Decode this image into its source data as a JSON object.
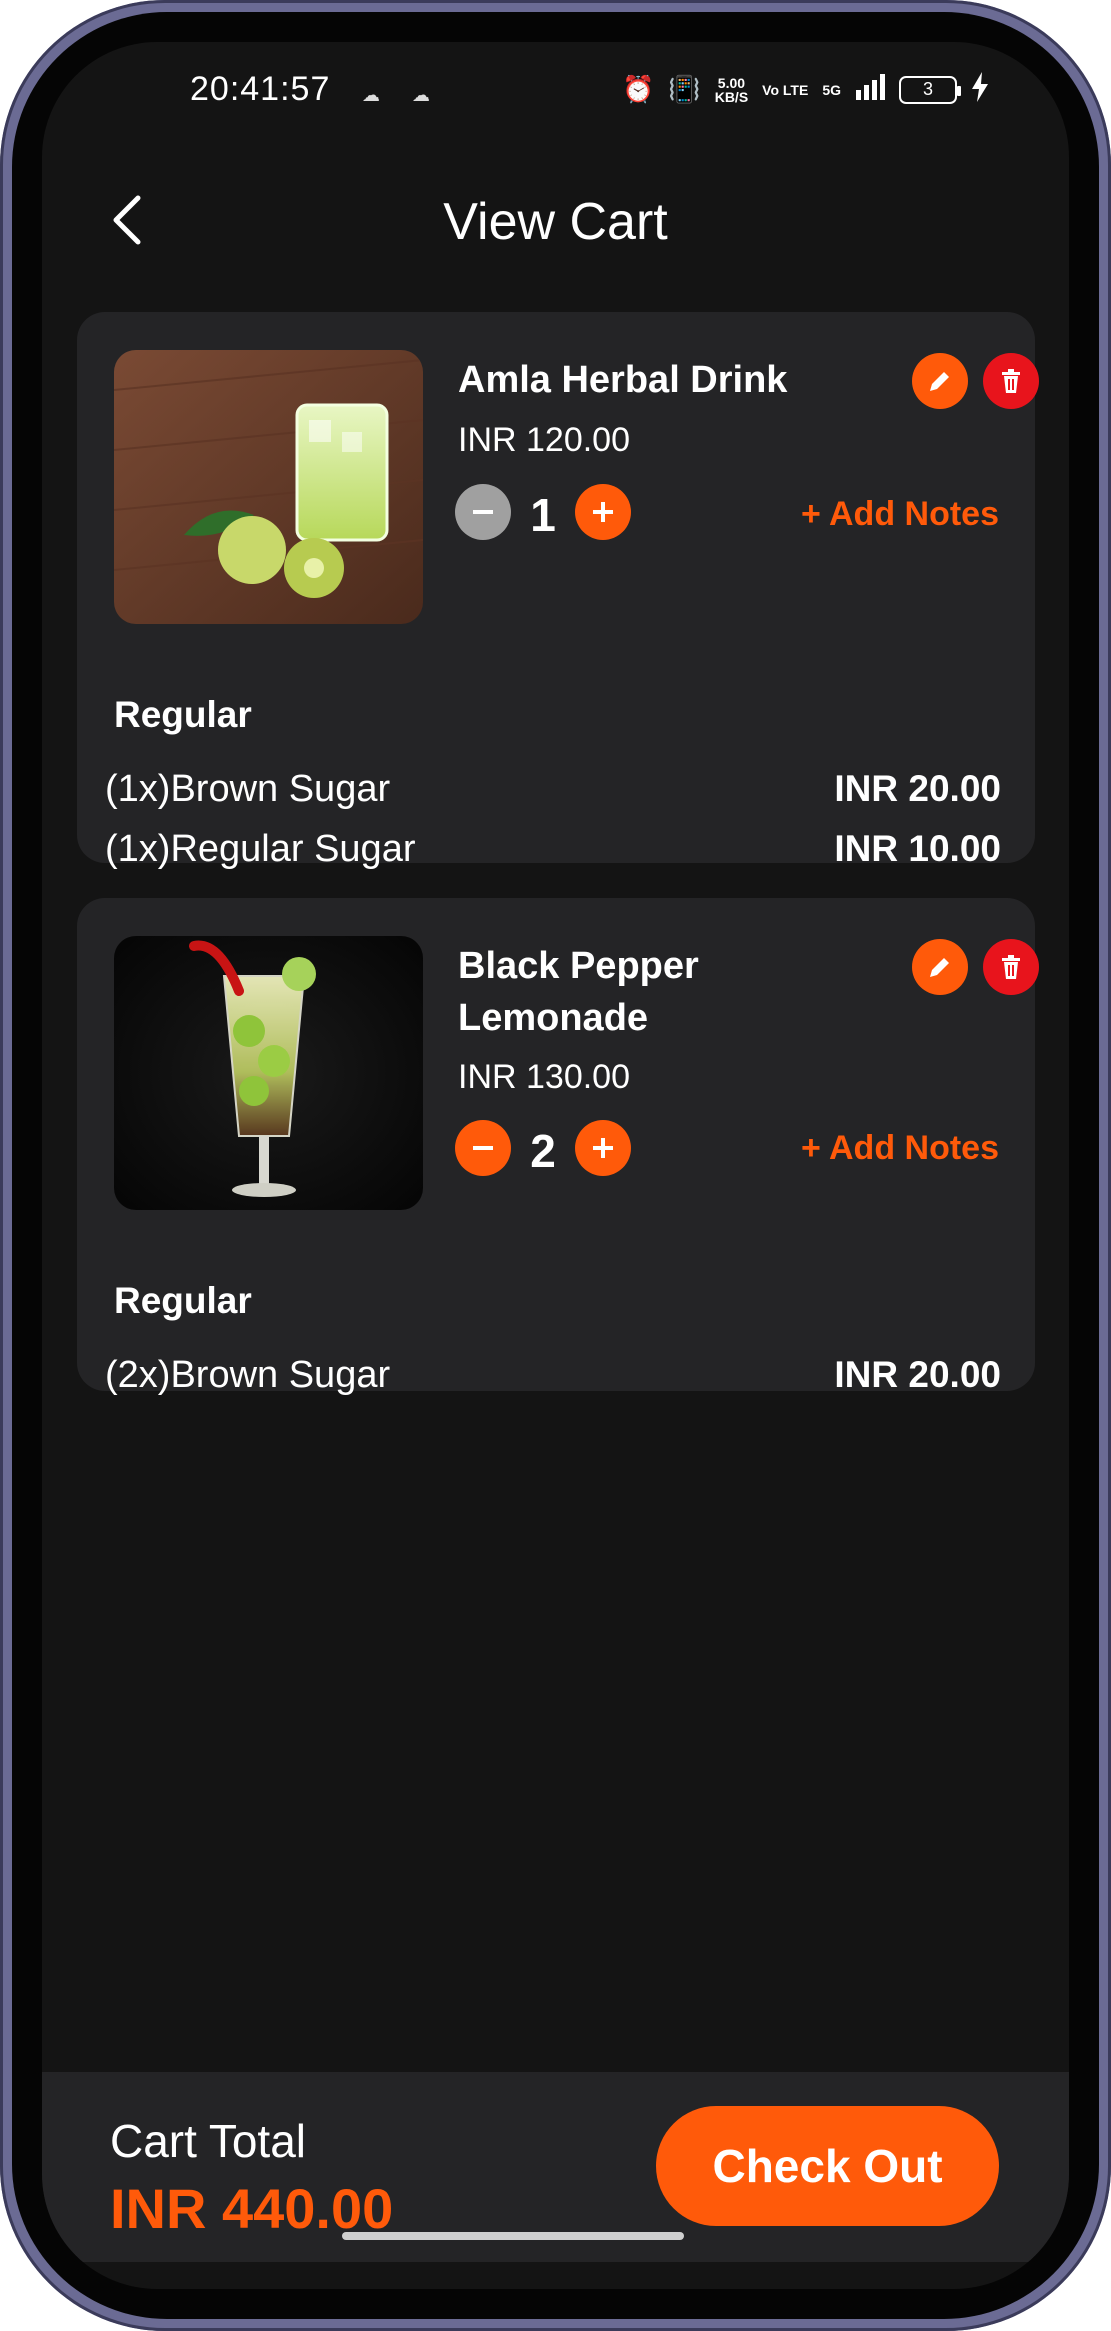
{
  "status": {
    "time": "20:41:57",
    "speed_top": "5.00",
    "speed_bottom": "KB/S",
    "volte": "Vo LTE",
    "network": "5G",
    "battery": "3"
  },
  "header": {
    "title": "View Cart",
    "back_icon": "chevron-left-icon"
  },
  "items": [
    {
      "name": "Amla Herbal Drink",
      "price": "INR 120.00",
      "quantity": "1",
      "add_notes": "+ Add Notes",
      "variant": "Regular",
      "addons": [
        {
          "name": "(1x)Brown Sugar",
          "price": "INR 20.00"
        },
        {
          "name": "(1x)Regular Sugar",
          "price": "INR 10.00"
        }
      ],
      "minus_enabled": false
    },
    {
      "name_line1": "Black Pepper",
      "name_line2": "Lemonade",
      "price": "INR 130.00",
      "quantity": "2",
      "add_notes": "+ Add Notes",
      "variant": "Regular",
      "addons": [
        {
          "name": "(2x)Brown Sugar",
          "price": "INR 20.00"
        }
      ],
      "minus_enabled": true
    }
  ],
  "footer": {
    "total_label": "Cart Total",
    "total_value": "INR 440.00",
    "checkout_label": "Check Out"
  },
  "colors": {
    "accent": "#ff5a0a",
    "delete": "#e8141c",
    "background": "#141414",
    "card": "#242426",
    "minus_disabled": "#a0a0a0"
  }
}
